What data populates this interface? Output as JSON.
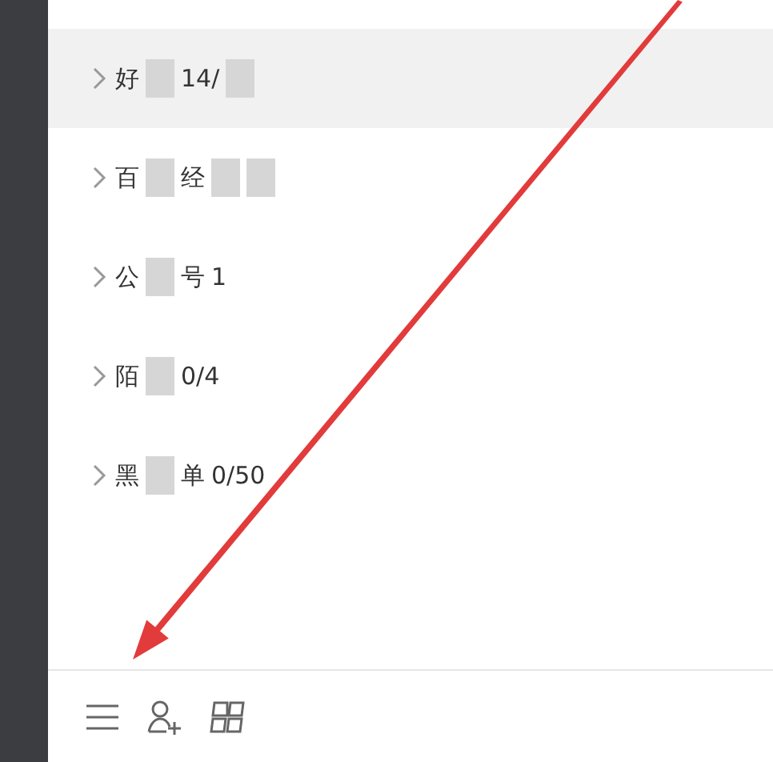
{
  "groups": [
    {
      "selected": true,
      "expanded": false,
      "segments": [
        {
          "kind": "text",
          "text": "好"
        },
        {
          "kind": "blur"
        },
        {
          "kind": "text",
          "text": "14/"
        },
        {
          "kind": "blur"
        }
      ]
    },
    {
      "selected": false,
      "expanded": false,
      "segments": [
        {
          "kind": "text",
          "text": "百"
        },
        {
          "kind": "blur"
        },
        {
          "kind": "text",
          "text": "经"
        },
        {
          "kind": "blur"
        },
        {
          "kind": "blur"
        }
      ]
    },
    {
      "selected": false,
      "expanded": false,
      "segments": [
        {
          "kind": "text",
          "text": "公"
        },
        {
          "kind": "blur"
        },
        {
          "kind": "text",
          "text": "号"
        },
        {
          "kind": "text",
          "text": "1"
        }
      ]
    },
    {
      "selected": false,
      "expanded": false,
      "segments": [
        {
          "kind": "text",
          "text": "陌"
        },
        {
          "kind": "blur"
        },
        {
          "kind": "text",
          "text": "0/4"
        }
      ]
    },
    {
      "selected": false,
      "expanded": false,
      "segments": [
        {
          "kind": "text",
          "text": "黑"
        },
        {
          "kind": "blur"
        },
        {
          "kind": "text",
          "text": "单"
        },
        {
          "kind": "text",
          "text": "0/50"
        }
      ]
    }
  ],
  "annotation": {
    "kind": "arrow"
  }
}
